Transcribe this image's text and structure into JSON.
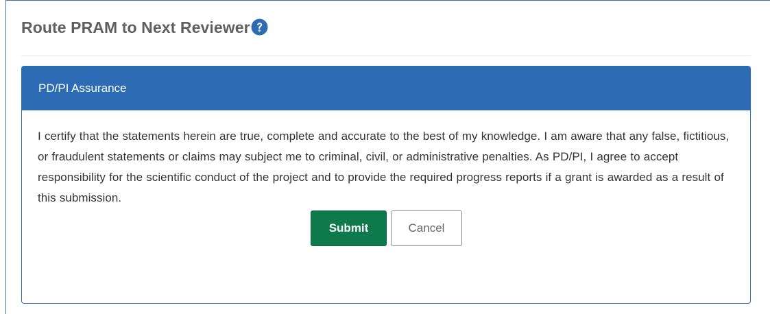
{
  "dialog": {
    "title": "Route PRAM to Next Reviewer",
    "help_icon": "question-circle-icon"
  },
  "panel": {
    "heading": "PD/PI Assurance",
    "body_text": "I certify that the statements herein are true, complete and accurate to the best of my knowledge. I am aware that any false, fictitious, or fraudulent statements or claims may subject me to criminal, civil, or administrative penalties. As PD/PI, I agree to accept responsibility for the scientific conduct of the project and to provide the required progress reports if a grant is awarded as a result of this submission."
  },
  "buttons": {
    "submit_label": "Submit",
    "cancel_label": "Cancel"
  },
  "colors": {
    "panel_header": "#2d6bb5",
    "submit_button": "#0e7a4c",
    "title_text": "#5f5f5f",
    "help_icon": "#2d6bb5"
  }
}
